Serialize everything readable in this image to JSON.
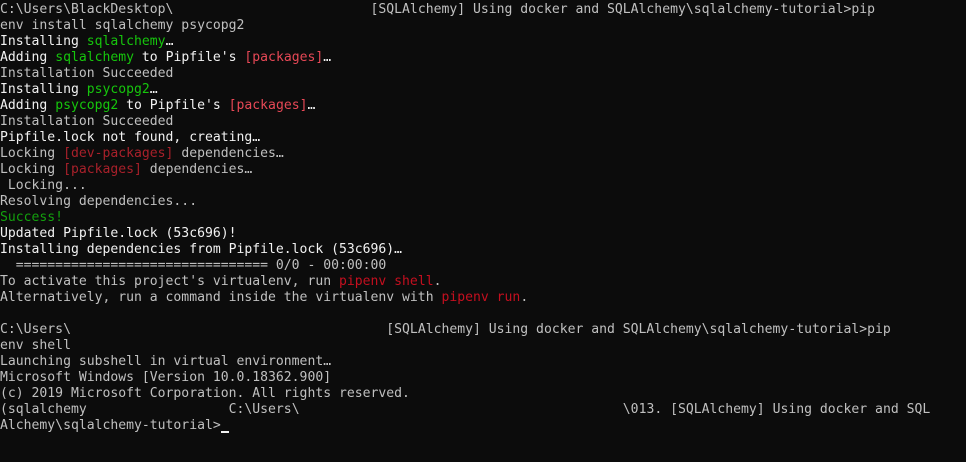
{
  "lines": [
    [
      {
        "t": "C:\\Users\\BlackDesktop\\",
        "c": "gray"
      },
      {
        "t": "                         ",
        "c": "gray"
      },
      {
        "t": "[SQLAlchemy] Using docker and SQLAlchemy\\sqlalchemy-tutorial>pip",
        "c": "gray"
      }
    ],
    [
      {
        "t": "env install sqlalchemy psycopg2",
        "c": "gray"
      }
    ],
    [
      {
        "t": "Installing ",
        "c": "bright"
      },
      {
        "t": "sqlalchemy",
        "c": "green"
      },
      {
        "t": "…",
        "c": "bright"
      }
    ],
    [
      {
        "t": "Adding ",
        "c": "bright"
      },
      {
        "t": "sqlalchemy",
        "c": "green"
      },
      {
        "t": " to Pipfile's ",
        "c": "bright"
      },
      {
        "t": "[packages]",
        "c": "red"
      },
      {
        "t": "…",
        "c": "bright"
      }
    ],
    [
      {
        "t": "Installation Succeeded",
        "c": "gray"
      }
    ],
    [
      {
        "t": "Installing ",
        "c": "bright"
      },
      {
        "t": "psycopg2",
        "c": "green"
      },
      {
        "t": "…",
        "c": "bright"
      }
    ],
    [
      {
        "t": "Adding ",
        "c": "bright"
      },
      {
        "t": "psycopg2",
        "c": "green"
      },
      {
        "t": " to Pipfile's ",
        "c": "bright"
      },
      {
        "t": "[packages]",
        "c": "red"
      },
      {
        "t": "…",
        "c": "bright"
      }
    ],
    [
      {
        "t": "Installation Succeeded",
        "c": "gray"
      }
    ],
    [
      {
        "t": "Pipfile.lock not found, creating…",
        "c": "bright"
      }
    ],
    [
      {
        "t": "Locking ",
        "c": "gray"
      },
      {
        "t": "[dev-packages]",
        "c": "dimred"
      },
      {
        "t": " dependencies…",
        "c": "gray"
      }
    ],
    [
      {
        "t": "Locking ",
        "c": "gray"
      },
      {
        "t": "[packages]",
        "c": "dimred"
      },
      {
        "t": " dependencies…",
        "c": "gray"
      }
    ],
    [
      {
        "t": " Locking...",
        "c": "gray"
      }
    ],
    [
      {
        "t": "Resolving dependencies...",
        "c": "gray"
      }
    ],
    [
      {
        "t": "Success!",
        "c": "dkgreen"
      }
    ],
    [
      {
        "t": "Updated Pipfile.lock (53c696)!",
        "c": "bright"
      }
    ],
    [
      {
        "t": "Installing dependencies from Pipfile.lock (53c696)…",
        "c": "bright"
      }
    ],
    [
      {
        "t": "  ================================ 0/0 - 00:00:00",
        "c": "gray"
      }
    ],
    [
      {
        "t": "To activate this project's virtualenv, run ",
        "c": "gray"
      },
      {
        "t": "pipenv shell",
        "c": "dkred"
      },
      {
        "t": ".",
        "c": "gray"
      }
    ],
    [
      {
        "t": "Alternatively, run a command inside the virtualenv with ",
        "c": "gray"
      },
      {
        "t": "pipenv run",
        "c": "dkred"
      },
      {
        "t": ".",
        "c": "gray"
      }
    ],
    [
      {
        "t": "",
        "c": "gray"
      }
    ],
    [
      {
        "t": "C:\\Users\\",
        "c": "gray"
      },
      {
        "t": "                                        ",
        "c": "gray"
      },
      {
        "t": "[SQLAlchemy] Using docker and SQLAlchemy\\sqlalchemy-tutorial>pip",
        "c": "gray"
      }
    ],
    [
      {
        "t": "env shell",
        "c": "gray"
      }
    ],
    [
      {
        "t": "Launching subshell in virtual environment…",
        "c": "gray"
      }
    ],
    [
      {
        "t": "Microsoft Windows [Version 10.0.18362.900]",
        "c": "gray"
      }
    ],
    [
      {
        "t": "(c) 2019 Microsoft Corporation. All rights reserved.",
        "c": "gray"
      }
    ],
    [
      {
        "t": "(sqlalchemy",
        "c": "gray"
      },
      {
        "t": "                  ",
        "c": "gray"
      },
      {
        "t": "C:\\Users\\",
        "c": "gray"
      },
      {
        "t": "                                         ",
        "c": "gray"
      },
      {
        "t": "\\013. [SQLAlchemy] Using docker and SQL",
        "c": "gray"
      }
    ],
    [
      {
        "t": "Alchemy\\sqlalchemy-tutorial>",
        "c": "gray"
      }
    ]
  ]
}
